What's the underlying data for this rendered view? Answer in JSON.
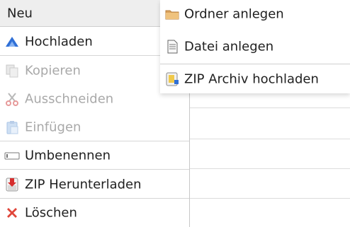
{
  "menu": {
    "top_label": "Neu",
    "items": [
      {
        "label": "Hochladen",
        "icon": "upload-arrow-icon",
        "enabled": true
      },
      {
        "label": "Kopieren",
        "icon": "copy-icon",
        "enabled": false
      },
      {
        "label": "Ausschneiden",
        "icon": "scissors-icon",
        "enabled": false
      },
      {
        "label": "Einfügen",
        "icon": "paste-icon",
        "enabled": false
      },
      {
        "label": "Umbenennen",
        "icon": "rename-icon",
        "enabled": true
      },
      {
        "label": "ZIP Herunterladen",
        "icon": "zip-download-icon",
        "enabled": true
      },
      {
        "label": "Löschen",
        "icon": "delete-x-icon",
        "enabled": true
      }
    ]
  },
  "submenu": {
    "items": [
      {
        "label": "Ordner anlegen",
        "icon": "folder-icon"
      },
      {
        "label": "Datei anlegen",
        "icon": "file-icon"
      },
      {
        "label": "ZIP Archiv hochladen",
        "icon": "zip-upload-icon"
      }
    ]
  },
  "colors": {
    "disabled_text": "#a9a9a9",
    "header_bg": "#eeeeee",
    "accent_blue": "#2f6fd6",
    "delete_red": "#e0463a"
  }
}
